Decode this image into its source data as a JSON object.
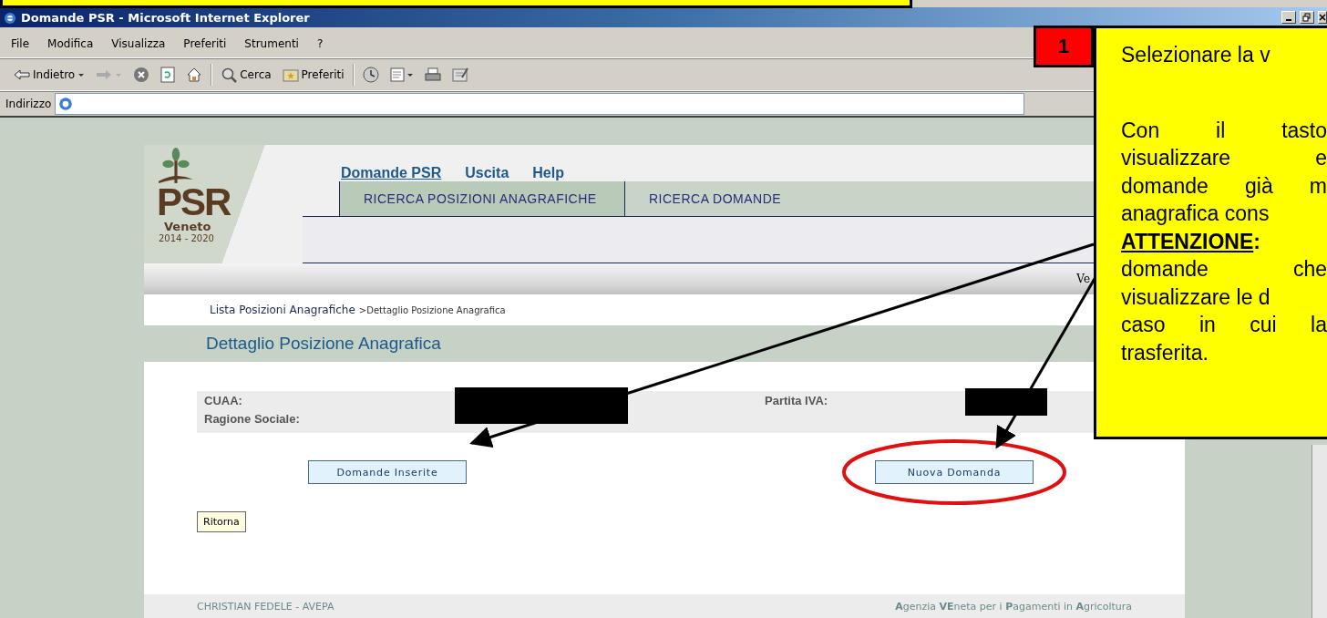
{
  "window": {
    "title": "Domande PSR - Microsoft Internet Explorer"
  },
  "menu": [
    "File",
    "Modifica",
    "Visualizza",
    "Preferiti",
    "Strumenti",
    "?"
  ],
  "toolbar": [
    {
      "kind": "back",
      "label": "Indietro"
    },
    {
      "kind": "forward"
    },
    {
      "kind": "stop"
    },
    {
      "kind": "refresh"
    },
    {
      "kind": "home"
    },
    {
      "kind": "search",
      "label": "Cerca"
    },
    {
      "kind": "favorites",
      "label": "Preferiti"
    },
    {
      "kind": "history"
    },
    {
      "kind": "mail"
    },
    {
      "kind": "print"
    },
    {
      "kind": "edit"
    }
  ],
  "address_bar": {
    "label": "Indirizzo"
  },
  "logo": {
    "name": "PSR",
    "region": "Veneto",
    "years": "2014 - 2020"
  },
  "nav_links": [
    {
      "label": "Domande PSR",
      "selected": true
    },
    {
      "label": "Uscita",
      "selected": false
    },
    {
      "label": "Help",
      "selected": false
    }
  ],
  "tabs": [
    {
      "label": "RICERCA POSIZIONI ANAGRAFICHE"
    },
    {
      "label": "RICERCA DOMANDE"
    }
  ],
  "version_text": "Ve",
  "breadcrumb": {
    "link": "Lista Posizioni Anagrafiche",
    "current": ">Dettaglio Posizione Anagrafica"
  },
  "page_title": "Dettaglio Posizione Anagrafica",
  "fields": [
    {
      "label": "CUAA:",
      "redacted": true
    },
    {
      "label": "Ragione Sociale:",
      "redacted": false
    },
    {
      "label": "Partita IVA:",
      "redacted": true
    }
  ],
  "buttons": [
    {
      "label": "Domande Inserite",
      "highlighted": false
    },
    {
      "label": "Nuova Domanda",
      "highlighted": true
    }
  ],
  "back_button": "Ritorna",
  "footer": {
    "left": "CHRISTIAN FEDELE - AVEPA",
    "right": "**A**genzia **VE**neta per i **P**agamenti in **A**gricoltura"
  },
  "callout": {
    "number": "1",
    "lines": [
      {
        "text": "Selezionare la v",
        "kind": "plain"
      },
      {
        "kind": "gap"
      },
      {
        "text": "Con il tasto",
        "kind": "justify"
      },
      {
        "text": "visualizzare e",
        "kind": "justify"
      },
      {
        "text": "domande già m",
        "kind": "justify"
      },
      {
        "text": "anagrafica cons",
        "kind": "plain"
      },
      {
        "text": "**ATTENZIONE**:",
        "kind": "warning"
      },
      {
        "text": "domande che",
        "kind": "justify"
      },
      {
        "text": "visualizzare le d",
        "kind": "plain"
      },
      {
        "text": "caso in cui la",
        "kind": "justify"
      },
      {
        "text": "trasferita.",
        "kind": "plain"
      }
    ]
  }
}
